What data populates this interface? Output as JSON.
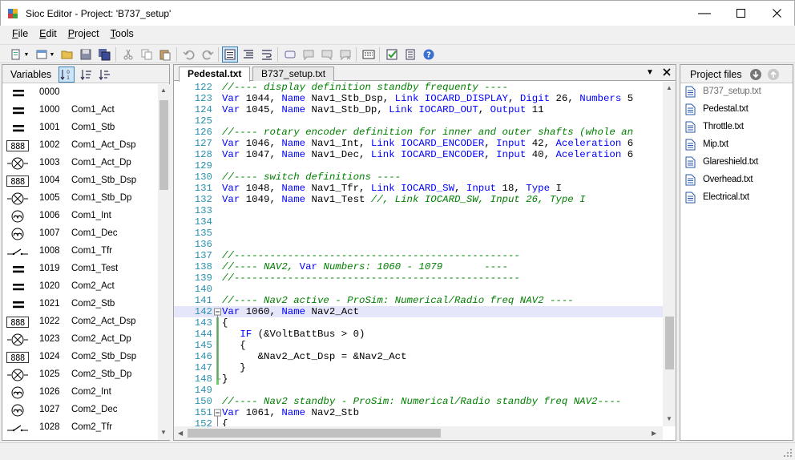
{
  "window": {
    "title": "Sioc Editor - Project: 'B737_setup'"
  },
  "menu": [
    {
      "label": "File",
      "key": "F",
      "rest": "ile"
    },
    {
      "label": "Edit",
      "key": "E",
      "rest": "dit"
    },
    {
      "label": "Project",
      "key": "P",
      "rest": "roject"
    },
    {
      "label": "Tools",
      "key": "T",
      "rest": "ools"
    }
  ],
  "variables_panel": {
    "title": "Variables",
    "items": [
      {
        "icon": "equals",
        "num": "0000",
        "name": ""
      },
      {
        "icon": "equals",
        "num": "1000",
        "name": "Com1_Act"
      },
      {
        "icon": "equals",
        "num": "1001",
        "name": "Com1_Stb"
      },
      {
        "icon": "display",
        "num": "1002",
        "name": "Com1_Act_Dsp"
      },
      {
        "icon": "output",
        "num": "1003",
        "name": "Com1_Act_Dp"
      },
      {
        "icon": "display",
        "num": "1004",
        "name": "Com1_Stb_Dsp"
      },
      {
        "icon": "output",
        "num": "1005",
        "name": "Com1_Stb_Dp"
      },
      {
        "icon": "encoder",
        "num": "1006",
        "name": "Com1_Int"
      },
      {
        "icon": "encoder",
        "num": "1007",
        "name": "Com1_Dec"
      },
      {
        "icon": "switch",
        "num": "1008",
        "name": "Com1_Tfr"
      },
      {
        "icon": "equals",
        "num": "1019",
        "name": "Com1_Test"
      },
      {
        "icon": "equals",
        "num": "1020",
        "name": "Com2_Act"
      },
      {
        "icon": "equals",
        "num": "1021",
        "name": "Com2_Stb"
      },
      {
        "icon": "display",
        "num": "1022",
        "name": "Com2_Act_Dsp"
      },
      {
        "icon": "output",
        "num": "1023",
        "name": "Com2_Act_Dp"
      },
      {
        "icon": "display",
        "num": "1024",
        "name": "Com2_Stb_Dsp"
      },
      {
        "icon": "output",
        "num": "1025",
        "name": "Com2_Stb_Dp"
      },
      {
        "icon": "encoder",
        "num": "1026",
        "name": "Com2_Int"
      },
      {
        "icon": "encoder",
        "num": "1027",
        "name": "Com2_Dec"
      },
      {
        "icon": "switch",
        "num": "1028",
        "name": "Com2_Tfr"
      }
    ]
  },
  "editor": {
    "tabs": [
      {
        "label": "Pedestal.txt",
        "active": true
      },
      {
        "label": "B737_setup.txt",
        "active": false
      }
    ],
    "lines": [
      {
        "n": "122",
        "fold": "",
        "hl": false,
        "green": false,
        "parts": [
          [
            "cm",
            "//---- display definition standby frequenty ----"
          ]
        ]
      },
      {
        "n": "123",
        "fold": "",
        "hl": false,
        "green": false,
        "parts": [
          [
            "kw",
            "Var"
          ],
          [
            "pl",
            " 1044, "
          ],
          [
            "kw",
            "Name"
          ],
          [
            "pl",
            " Nav1_Stb_Dsp, "
          ],
          [
            "kw",
            "Link"
          ],
          [
            "pl",
            " "
          ],
          [
            "kw",
            "IOCARD_DISPLAY"
          ],
          [
            "pl",
            ", "
          ],
          [
            "kw",
            "Digit"
          ],
          [
            "pl",
            " 26, "
          ],
          [
            "kw",
            "Numbers"
          ],
          [
            "pl",
            " 5"
          ]
        ]
      },
      {
        "n": "124",
        "fold": "",
        "hl": false,
        "green": false,
        "parts": [
          [
            "kw",
            "Var"
          ],
          [
            "pl",
            " 1045, "
          ],
          [
            "kw",
            "Name"
          ],
          [
            "pl",
            " Nav1_Stb_Dp, "
          ],
          [
            "kw",
            "Link"
          ],
          [
            "pl",
            " "
          ],
          [
            "kw",
            "IOCARD_OUT"
          ],
          [
            "pl",
            ", "
          ],
          [
            "kw",
            "Output"
          ],
          [
            "pl",
            " 11"
          ]
        ]
      },
      {
        "n": "125",
        "fold": "",
        "hl": false,
        "green": false,
        "parts": []
      },
      {
        "n": "126",
        "fold": "",
        "hl": false,
        "green": false,
        "parts": [
          [
            "cm",
            "//---- rotary encoder definition for inner and outer shafts (whole an"
          ]
        ]
      },
      {
        "n": "127",
        "fold": "",
        "hl": false,
        "green": false,
        "parts": [
          [
            "kw",
            "Var"
          ],
          [
            "pl",
            " 1046, "
          ],
          [
            "kw",
            "Name"
          ],
          [
            "pl",
            " Nav1_Int, "
          ],
          [
            "kw",
            "Link"
          ],
          [
            "pl",
            " "
          ],
          [
            "kw",
            "IOCARD_ENCODER"
          ],
          [
            "pl",
            ", "
          ],
          [
            "kw",
            "Input"
          ],
          [
            "pl",
            " 42, "
          ],
          [
            "kw",
            "Aceleration"
          ],
          [
            "pl",
            " 6"
          ]
        ]
      },
      {
        "n": "128",
        "fold": "",
        "hl": false,
        "green": false,
        "parts": [
          [
            "kw",
            "Var"
          ],
          [
            "pl",
            " 1047, "
          ],
          [
            "kw",
            "Name"
          ],
          [
            "pl",
            " Nav1_Dec, "
          ],
          [
            "kw",
            "Link"
          ],
          [
            "pl",
            " "
          ],
          [
            "kw",
            "IOCARD_ENCODER"
          ],
          [
            "pl",
            ", "
          ],
          [
            "kw",
            "Input"
          ],
          [
            "pl",
            " 40, "
          ],
          [
            "kw",
            "Aceleration"
          ],
          [
            "pl",
            " 6"
          ]
        ]
      },
      {
        "n": "129",
        "fold": "",
        "hl": false,
        "green": false,
        "parts": []
      },
      {
        "n": "130",
        "fold": "",
        "hl": false,
        "green": false,
        "parts": [
          [
            "cm",
            "//---- switch definitions ----"
          ]
        ]
      },
      {
        "n": "131",
        "fold": "",
        "hl": false,
        "green": false,
        "parts": [
          [
            "kw",
            "Var"
          ],
          [
            "pl",
            " 1048, "
          ],
          [
            "kw",
            "Name"
          ],
          [
            "pl",
            " Nav1_Tfr, "
          ],
          [
            "kw",
            "Link"
          ],
          [
            "pl",
            " "
          ],
          [
            "kw",
            "IOCARD_SW"
          ],
          [
            "pl",
            ", "
          ],
          [
            "kw",
            "Input"
          ],
          [
            "pl",
            " 18, "
          ],
          [
            "kw",
            "Type"
          ],
          [
            "pl",
            " I"
          ]
        ]
      },
      {
        "n": "132",
        "fold": "",
        "hl": false,
        "green": false,
        "parts": [
          [
            "kw",
            "Var"
          ],
          [
            "pl",
            " 1049, "
          ],
          [
            "kw",
            "Name"
          ],
          [
            "pl",
            " Nav1_Test "
          ],
          [
            "cm",
            "//, Link IOCARD_SW, Input 26, Type I"
          ]
        ]
      },
      {
        "n": "133",
        "fold": "",
        "hl": false,
        "green": false,
        "parts": []
      },
      {
        "n": "134",
        "fold": "",
        "hl": false,
        "green": false,
        "parts": []
      },
      {
        "n": "135",
        "fold": "",
        "hl": false,
        "green": false,
        "parts": []
      },
      {
        "n": "136",
        "fold": "",
        "hl": false,
        "green": false,
        "parts": []
      },
      {
        "n": "137",
        "fold": "",
        "hl": false,
        "green": false,
        "parts": [
          [
            "cm",
            "//------------------------------------------------"
          ]
        ]
      },
      {
        "n": "138",
        "fold": "",
        "hl": false,
        "green": false,
        "parts": [
          [
            "cm",
            "//---- NAV2, "
          ],
          [
            "kw",
            "Var"
          ],
          [
            "cm",
            " Numbers: 1060 - 1079       ----"
          ]
        ]
      },
      {
        "n": "139",
        "fold": "",
        "hl": false,
        "green": false,
        "parts": [
          [
            "cm",
            "//------------------------------------------------"
          ]
        ]
      },
      {
        "n": "140",
        "fold": "",
        "hl": false,
        "green": false,
        "parts": []
      },
      {
        "n": "141",
        "fold": "",
        "hl": false,
        "green": false,
        "parts": [
          [
            "cm",
            "//---- Nav2 active - ProSim: Numerical/Radio freq NAV2 ----"
          ]
        ]
      },
      {
        "n": "142",
        "fold": "minus",
        "hl": true,
        "green": false,
        "parts": [
          [
            "kw",
            "Var"
          ],
          [
            "pl",
            " 1060, "
          ],
          [
            "kw",
            "Name"
          ],
          [
            "pl",
            " Nav2_Act"
          ]
        ]
      },
      {
        "n": "143",
        "fold": "line",
        "hl": false,
        "green": true,
        "parts": [
          [
            "pl",
            "{"
          ]
        ]
      },
      {
        "n": "144",
        "fold": "line",
        "hl": false,
        "green": true,
        "parts": [
          [
            "pl",
            "   "
          ],
          [
            "kw",
            "IF"
          ],
          [
            "pl",
            " (&VoltBattBus > 0)"
          ]
        ]
      },
      {
        "n": "145",
        "fold": "line",
        "hl": false,
        "green": true,
        "parts": [
          [
            "pl",
            "   {"
          ]
        ]
      },
      {
        "n": "146",
        "fold": "line",
        "hl": false,
        "green": true,
        "parts": [
          [
            "pl",
            "      &Nav2_Act_Dsp = &Nav2_Act"
          ]
        ]
      },
      {
        "n": "147",
        "fold": "line",
        "hl": false,
        "green": true,
        "parts": [
          [
            "pl",
            "   }"
          ]
        ]
      },
      {
        "n": "148",
        "fold": "end",
        "hl": false,
        "green": true,
        "parts": [
          [
            "pl",
            "}"
          ]
        ]
      },
      {
        "n": "149",
        "fold": "",
        "hl": false,
        "green": false,
        "parts": []
      },
      {
        "n": "150",
        "fold": "",
        "hl": false,
        "green": false,
        "parts": [
          [
            "cm",
            "//---- Nav2 standby - ProSim: Numerical/Radio standby freq NAV2----"
          ]
        ]
      },
      {
        "n": "151",
        "fold": "minus",
        "hl": false,
        "green": false,
        "parts": [
          [
            "kw",
            "Var"
          ],
          [
            "pl",
            " 1061, "
          ],
          [
            "kw",
            "Name"
          ],
          [
            "pl",
            " Nav2_Stb"
          ]
        ]
      },
      {
        "n": "152",
        "fold": "line",
        "hl": false,
        "green": false,
        "parts": [
          [
            "pl",
            "{"
          ]
        ]
      }
    ]
  },
  "project_files": {
    "title": "Project files",
    "items": [
      {
        "name": "B737_setup.txt",
        "grey": true
      },
      {
        "name": "Pedestal.txt",
        "grey": false
      },
      {
        "name": "Throttle.txt",
        "grey": false
      },
      {
        "name": "Mip.txt",
        "grey": false
      },
      {
        "name": "Glareshield.txt",
        "grey": false
      },
      {
        "name": "Overhead.txt",
        "grey": false
      },
      {
        "name": "Electrical.txt",
        "grey": false
      }
    ]
  },
  "colors": {
    "keyword": "#0000ff",
    "comment": "#008000",
    "linenum": "#2b91af",
    "highlight": "#e6e6fa"
  }
}
